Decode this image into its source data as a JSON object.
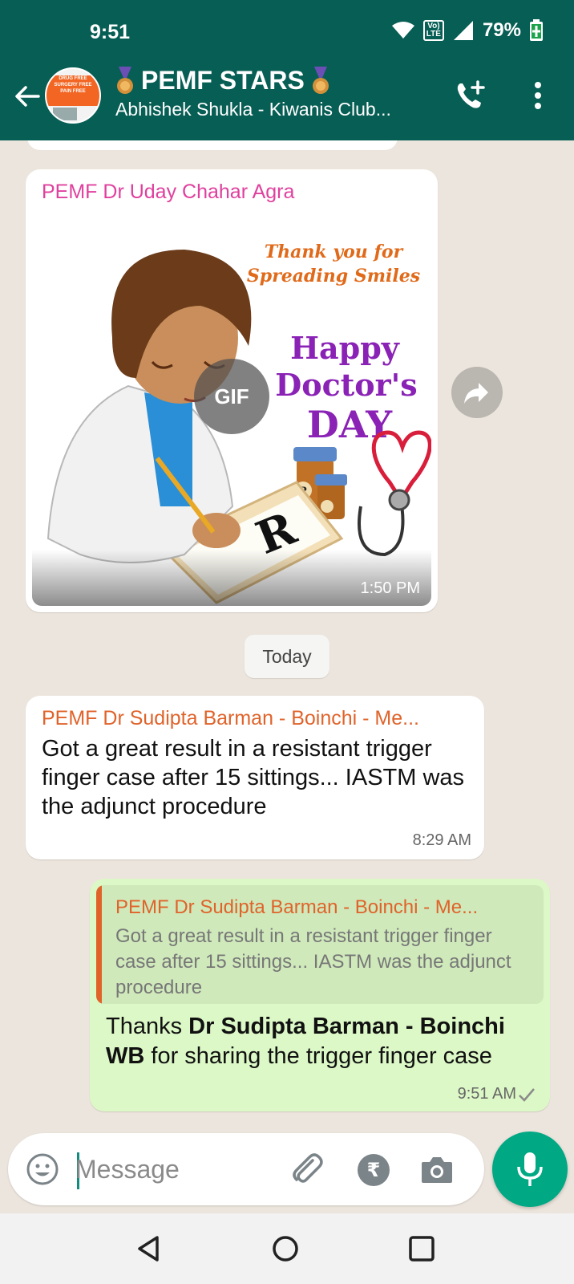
{
  "status_bar": {
    "time": "9:51",
    "network_badge_top": "Vo)",
    "network_badge_bottom": "LTE",
    "battery_percent": "79%"
  },
  "header": {
    "group_name": "PEMF STARS",
    "subtitle": "Abhishek Shukla - Kiwanis Club...",
    "avatar_lines": [
      "DRUG FREE",
      "SURGERY FREE",
      "PAIN FREE"
    ]
  },
  "messages": [
    {
      "type": "gif",
      "direction": "incoming",
      "sender": "PEMF Dr Uday Chahar Agra",
      "badge": "GIF",
      "time": "1:50 PM",
      "image_text": {
        "line1": "Thank you for",
        "line2": "Spreading Smiles",
        "line3": "Happy",
        "line4": "Doctor's",
        "line5": "DAY"
      }
    },
    {
      "type": "text",
      "direction": "incoming",
      "sender": "PEMF Dr Sudipta Barman - Boinchi - Me...",
      "text": "Got a great result in a resistant trigger finger case  after 15 sittings... IASTM was the adjunct procedure",
      "time": "8:29 AM"
    },
    {
      "type": "reply",
      "direction": "outgoing",
      "quoted_sender": "PEMF Dr Sudipta Barman - Boinchi - Me...",
      "quoted_text": "Got a great result in a resistant trigger finger case  after 15 sittings... IASTM was the adjunct procedure",
      "text_prefix": "Thanks ",
      "text_bold": "Dr Sudipta Barman - Boinchi WB",
      "text_suffix": " for sharing the trigger finger case",
      "time": "9:51 AM",
      "status": "sent"
    }
  ],
  "date_separator": "Today",
  "composer": {
    "placeholder": "Message",
    "rupee_symbol": "₹"
  },
  "colors": {
    "header_bg": "#075e54",
    "chat_bg": "#ece5dd",
    "outgoing_bubble": "#dcf8c6",
    "incoming_bubble": "#ffffff",
    "mic_button": "#00a884",
    "sender_pink": "#e0409e",
    "sender_orange": "#e0632a"
  }
}
